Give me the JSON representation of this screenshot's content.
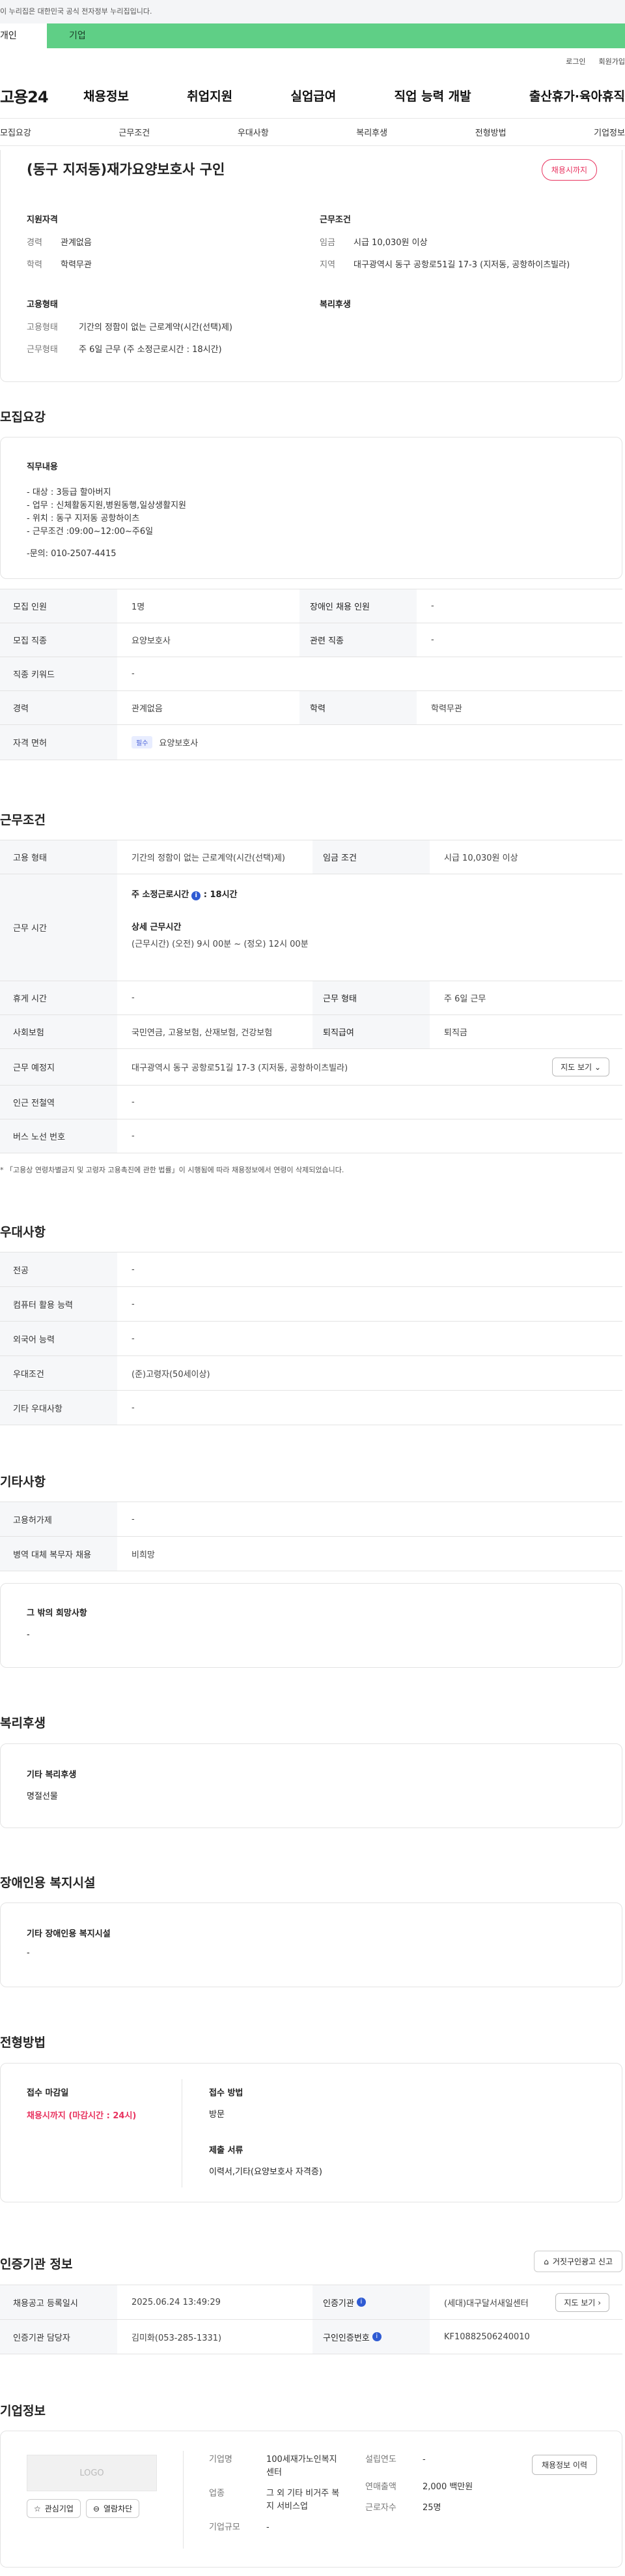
{
  "top": {
    "gov_notice": "이 누리집은 대한민국 공식 전자정부 누리집입니다.",
    "tab_personal": "개인",
    "tab_company": "기업",
    "login": "로그인",
    "signup": "회원가입"
  },
  "gnb": {
    "logo": "고용24",
    "menu": [
      "채용정보",
      "취업지원",
      "실업급여",
      "직업 능력 개발",
      "출산휴가·육아휴직"
    ]
  },
  "subnav": [
    "모집요강",
    "근무조건",
    "우대사항",
    "복리후생",
    "전형방법",
    "기업정보"
  ],
  "summary": {
    "title": "(동구 지저동)재가요양보호사 구인",
    "badge": "채용시까지",
    "qual_head": "지원자격",
    "career_k": "경력",
    "career_v": "관계없음",
    "edu_k": "학력",
    "edu_v": "학력무관",
    "work_head": "근무조건",
    "wage_k": "임금",
    "wage_v": "시급 10,030원 이상",
    "area_k": "지역",
    "area_v": "대구광역시 동구 공항로51길 17-3 (지저동, 공항하이츠빌라)",
    "emp_head": "고용형태",
    "emptype_k": "고용형태",
    "emptype_v": "기간의 정함이 없는 근로계약(시간(선택)제)",
    "workform_k": "근무형태",
    "workform_v": "주 6일 근무 (주 소정근로시간 : 18시간)",
    "welfare_head": "복리후생"
  },
  "recruit": {
    "title": "모집요강",
    "duty_head": "직무내용",
    "duty_lines": [
      "- 대상 : 3등급 할아버지",
      "- 업무 : 신체활동지원,병원동행,일상생활지원",
      "- 위치 : 동구 지저동 공항하이츠",
      "- 근무조건 :09:00~12:00~주6일",
      "",
      "-문의: 010-2507-4415"
    ],
    "rows": {
      "headcount_h": "모집 인원",
      "headcount_v": "1명",
      "disabled_h": "장애인 채용 인원",
      "disabled_v": "-",
      "job_h": "모집 직종",
      "job_v": "요양보호사",
      "related_h": "관련 직종",
      "related_v": "-",
      "keyword_h": "직종 키워드",
      "keyword_v": "-",
      "career_h": "경력",
      "career_v": "관계없음",
      "edu_h": "학력",
      "edu_v": "학력무관",
      "license_h": "자격 면허",
      "license_tag": "필수",
      "license_v": "요양보호사"
    }
  },
  "conditions": {
    "title": "근무조건",
    "emptype_h": "고용 형태",
    "emptype_v": "기간의 정함이 없는 근로계약(시간(선택)제)",
    "wage_h": "임금 조건",
    "wage_v": "시급 10,030원 이상",
    "hours_h": "근무 시간",
    "hours_week": "주 소정근로시간",
    "hours_week_v": ": 18시간",
    "hours_detail_head": "상세 근무시간",
    "hours_detail": "(근무시간) (오전) 9시 00분 ~ (정오) 12시 00분",
    "break_h": "휴게 시간",
    "break_v": "-",
    "workform_h": "근무 형태",
    "workform_v": "주 6일 근무",
    "insurance_h": "사회보험",
    "insurance_v": "국민연금, 고용보험, 산재보험, 건강보험",
    "severance_h": "퇴직급여",
    "severance_v": "퇴직금",
    "place_h": "근무 예정지",
    "place_v": "대구광역시 동구 공항로51길 17-3 (지저동, 공항하이츠빌라)",
    "map_btn": "지도 보기",
    "subway_h": "인근 전철역",
    "subway_v": "-",
    "bus_h": "버스 노선 번호",
    "bus_v": "-",
    "notice": "* 「고용상 연령차별금지 및 고령자 고용촉진에 관한 법률」이 시행됨에 따라 채용정보에서 연령이 삭제되었습니다."
  },
  "preference": {
    "title": "우대사항",
    "major_h": "전공",
    "major_v": "-",
    "pc_h": "컴퓨터 활용 능력",
    "pc_v": "-",
    "lang_h": "외국어 능력",
    "lang_v": "-",
    "cond_h": "우대조건",
    "cond_v": "(준)고령자(50세이상)",
    "other_h": "기타 우대사항",
    "other_v": "-"
  },
  "etc": {
    "title": "기타사항",
    "permit_h": "고용허가제",
    "permit_v": "-",
    "military_h": "병역 대체 복무자 채용",
    "military_v": "비희망",
    "wish_head": "그 밖의 희망사항",
    "wish_v": "-"
  },
  "welfare": {
    "title": "복리후생",
    "head": "기타 복리후생",
    "value": "명절선물"
  },
  "disability": {
    "title": "장애인용 복지시설",
    "head": "기타 장애인용 복지시설",
    "value": "-"
  },
  "selection": {
    "title": "전형방법",
    "deadline_head": "접수 마감일",
    "deadline_v": "채용시까지 (마감시간 : 24시)",
    "method_head": "접수 방법",
    "method_v": "방문",
    "docs_head": "제출 서류",
    "docs_v": "이력서,기타(요양보호사 자격증)"
  },
  "cert": {
    "title": "인증기관 정보",
    "report_btn": "거짓구인광고 신고",
    "regdate_h": "채용공고 등록일시",
    "regdate_v": "2025.06.24 13:49:29",
    "org_h": "인증기관",
    "org_v": "(세대)대구달서새일센터",
    "org_btn": "지도 보기",
    "manager_h": "인증기관 담당자",
    "manager_v": "김미화(053-285-1331)",
    "certno_h": "구인인증번호",
    "certno_v": "KF10882506240010"
  },
  "company": {
    "title": "기업정보",
    "logo": "LOGO",
    "fav_btn": "관심기업",
    "block_btn": "열람차단",
    "name_k": "기업명",
    "name_v": "100세재가노인복지센터",
    "industry_k": "업종",
    "industry_v": "그 외 기타 비거주 복지 서비스업",
    "size_k": "기업규모",
    "size_v": "-",
    "year_k": "설립연도",
    "year_v": "-",
    "sales_k": "연매출액",
    "sales_v": "2,000 백만원",
    "workers_k": "근로자수",
    "workers_v": "25명",
    "history_btn": "채용정보 이력"
  },
  "colors": {
    "accent_green": "#5fcf86",
    "accent_red": "#e8335f",
    "info_blue": "#2f5bd3"
  }
}
